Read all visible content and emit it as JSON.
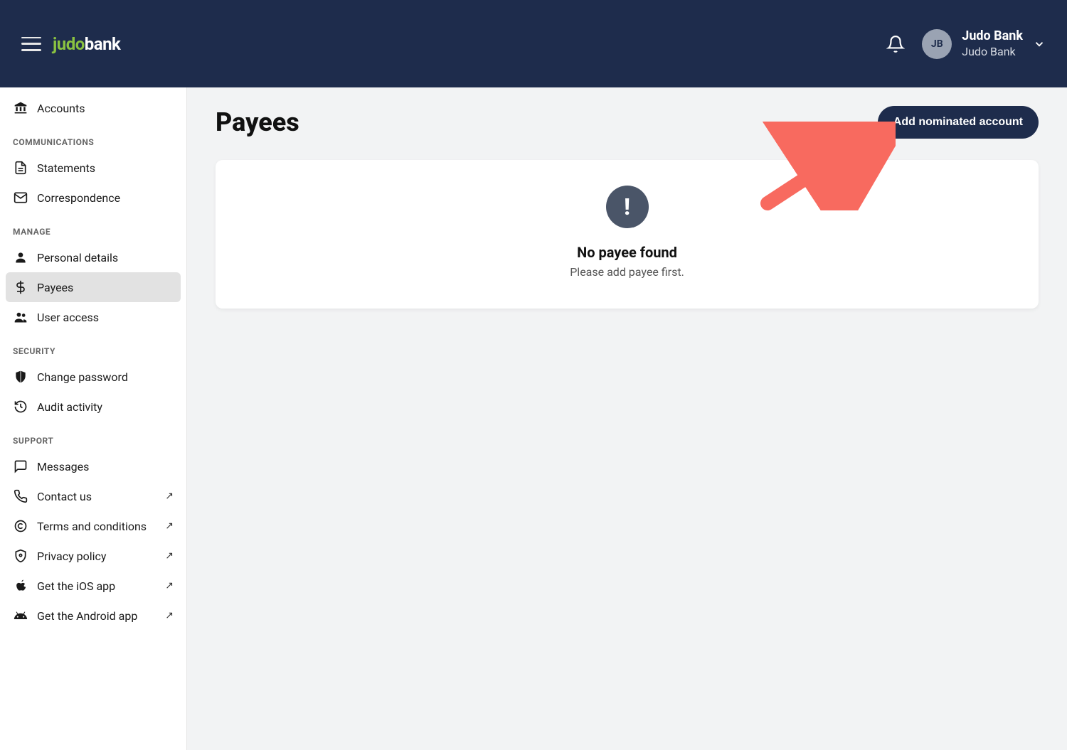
{
  "header": {
    "logo_part1": "judo",
    "logo_part2": "bank",
    "user_initials": "JB",
    "user_name": "Judo Bank",
    "user_subtitle": "Judo Bank"
  },
  "sidebar": {
    "accounts_label": "Accounts",
    "sections": {
      "communications": {
        "label": "COMMUNICATIONS",
        "statements": "Statements",
        "correspondence": "Correspondence"
      },
      "manage": {
        "label": "MANAGE",
        "personal_details": "Personal details",
        "payees": "Payees",
        "user_access": "User access"
      },
      "security": {
        "label": "SECURITY",
        "change_password": "Change password",
        "audit_activity": "Audit activity"
      },
      "support": {
        "label": "SUPPORT",
        "messages": "Messages",
        "contact_us": "Contact us",
        "terms": "Terms and conditions",
        "privacy": "Privacy policy",
        "ios_app": "Get the iOS app",
        "android_app": "Get the Android app"
      }
    }
  },
  "main": {
    "page_title": "Payees",
    "add_button": "Add nominated account",
    "empty_state": {
      "icon_glyph": "!",
      "title": "No payee found",
      "subtitle": "Please add payee first."
    }
  }
}
